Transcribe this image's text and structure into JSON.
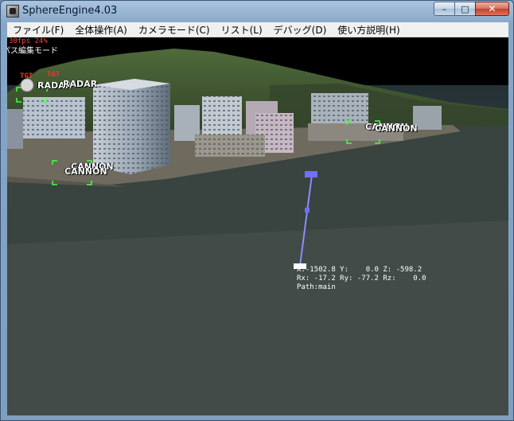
{
  "window": {
    "title": "SphereEngine4.03",
    "minimize_glyph": "–",
    "maximize_glyph": "□",
    "close_glyph": "✕"
  },
  "menu": [
    {
      "label": "ファイル(F)"
    },
    {
      "label": "全体操作(A)"
    },
    {
      "label": "カメラモード(C)"
    },
    {
      "label": "リスト(L)"
    },
    {
      "label": "デバッグ(D)"
    },
    {
      "label": "使い方説明(H)"
    }
  ],
  "hud": {
    "fps": "30fps  24%",
    "mode": "パス編集モード"
  },
  "targets": {
    "tgt1": "TGT",
    "tgt2": "TGT",
    "radar1": "RADAR",
    "radar2": "RADAR",
    "cannon1": "CANNON",
    "cannon2": "CANNON",
    "cannon3": "CANNON",
    "cannon4": "CANNON"
  },
  "coords": {
    "line1": "X:-1502.8 Y:    0.0 Z: -598.2",
    "line2": "Rx: -17.2 Ry: -77.2 Rz:    0.0",
    "line3": "Path:main"
  },
  "colors": {
    "sea": "#3a4645",
    "path_line": "#8c8cff",
    "target_marker": "#44ff44",
    "fps_text": "#ff4040"
  }
}
